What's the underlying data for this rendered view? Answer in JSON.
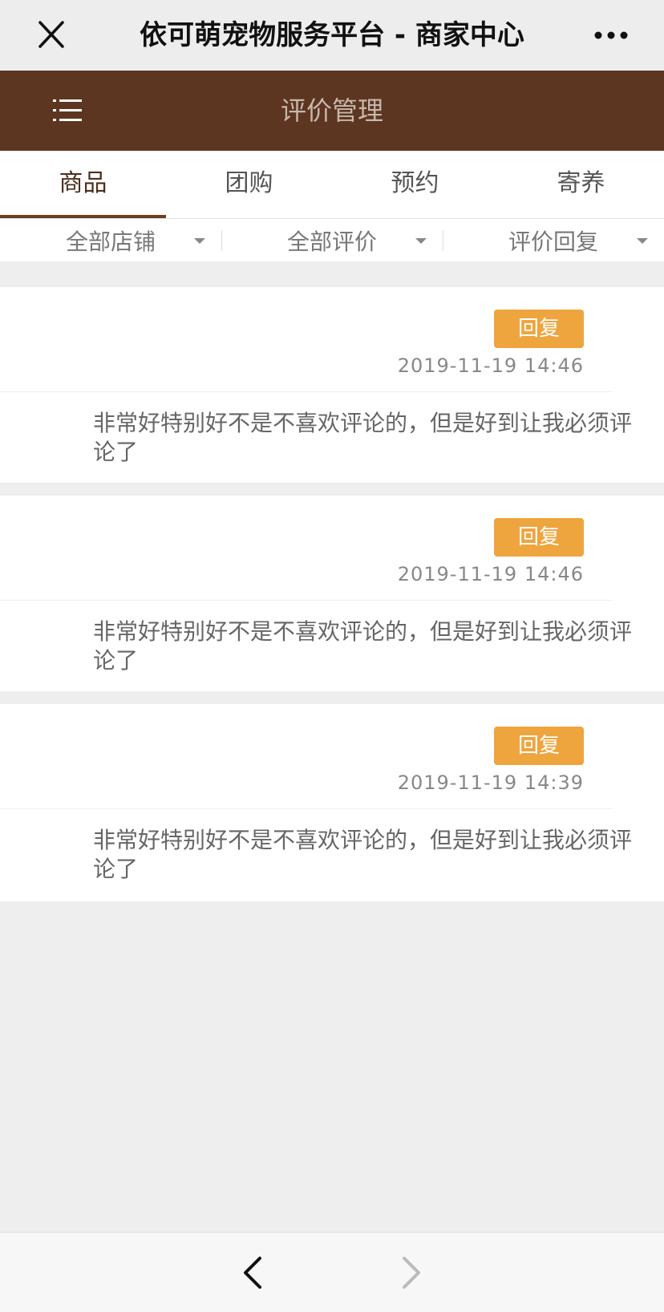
{
  "wechat_bar": {
    "title": "依可萌宠物服务平台 - 商家中心",
    "close_icon": "close-icon",
    "more_icon": "more-icon"
  },
  "header": {
    "title": "评价管理",
    "menu_icon": "menu-icon",
    "background": "#5c3621"
  },
  "tabs": [
    {
      "label": "商品",
      "active": true
    },
    {
      "label": "团购",
      "active": false
    },
    {
      "label": "预约",
      "active": false
    },
    {
      "label": "寄养",
      "active": false
    }
  ],
  "filters": [
    {
      "label": "全部店铺"
    },
    {
      "label": "全部评价"
    },
    {
      "label": "评价回复"
    }
  ],
  "reviews": [
    {
      "reply_label": "回复",
      "time": "2019-11-19 14:46",
      "comment": "非常好特别好不是不喜欢评论的，但是好到让我必须评论了"
    },
    {
      "reply_label": "回复",
      "time": "2019-11-19 14:46",
      "comment": "非常好特别好不是不喜欢评论的，但是好到让我必须评论了"
    },
    {
      "reply_label": "回复",
      "time": "2019-11-19 14:39",
      "comment": "非常好特别好不是不喜欢评论的，但是好到让我必须评论了"
    }
  ],
  "bottom_nav": {
    "back_icon": "chevron-left-icon",
    "forward_icon": "chevron-right-icon"
  },
  "colors": {
    "accent": "#eea53e",
    "brand": "#5c3621"
  }
}
